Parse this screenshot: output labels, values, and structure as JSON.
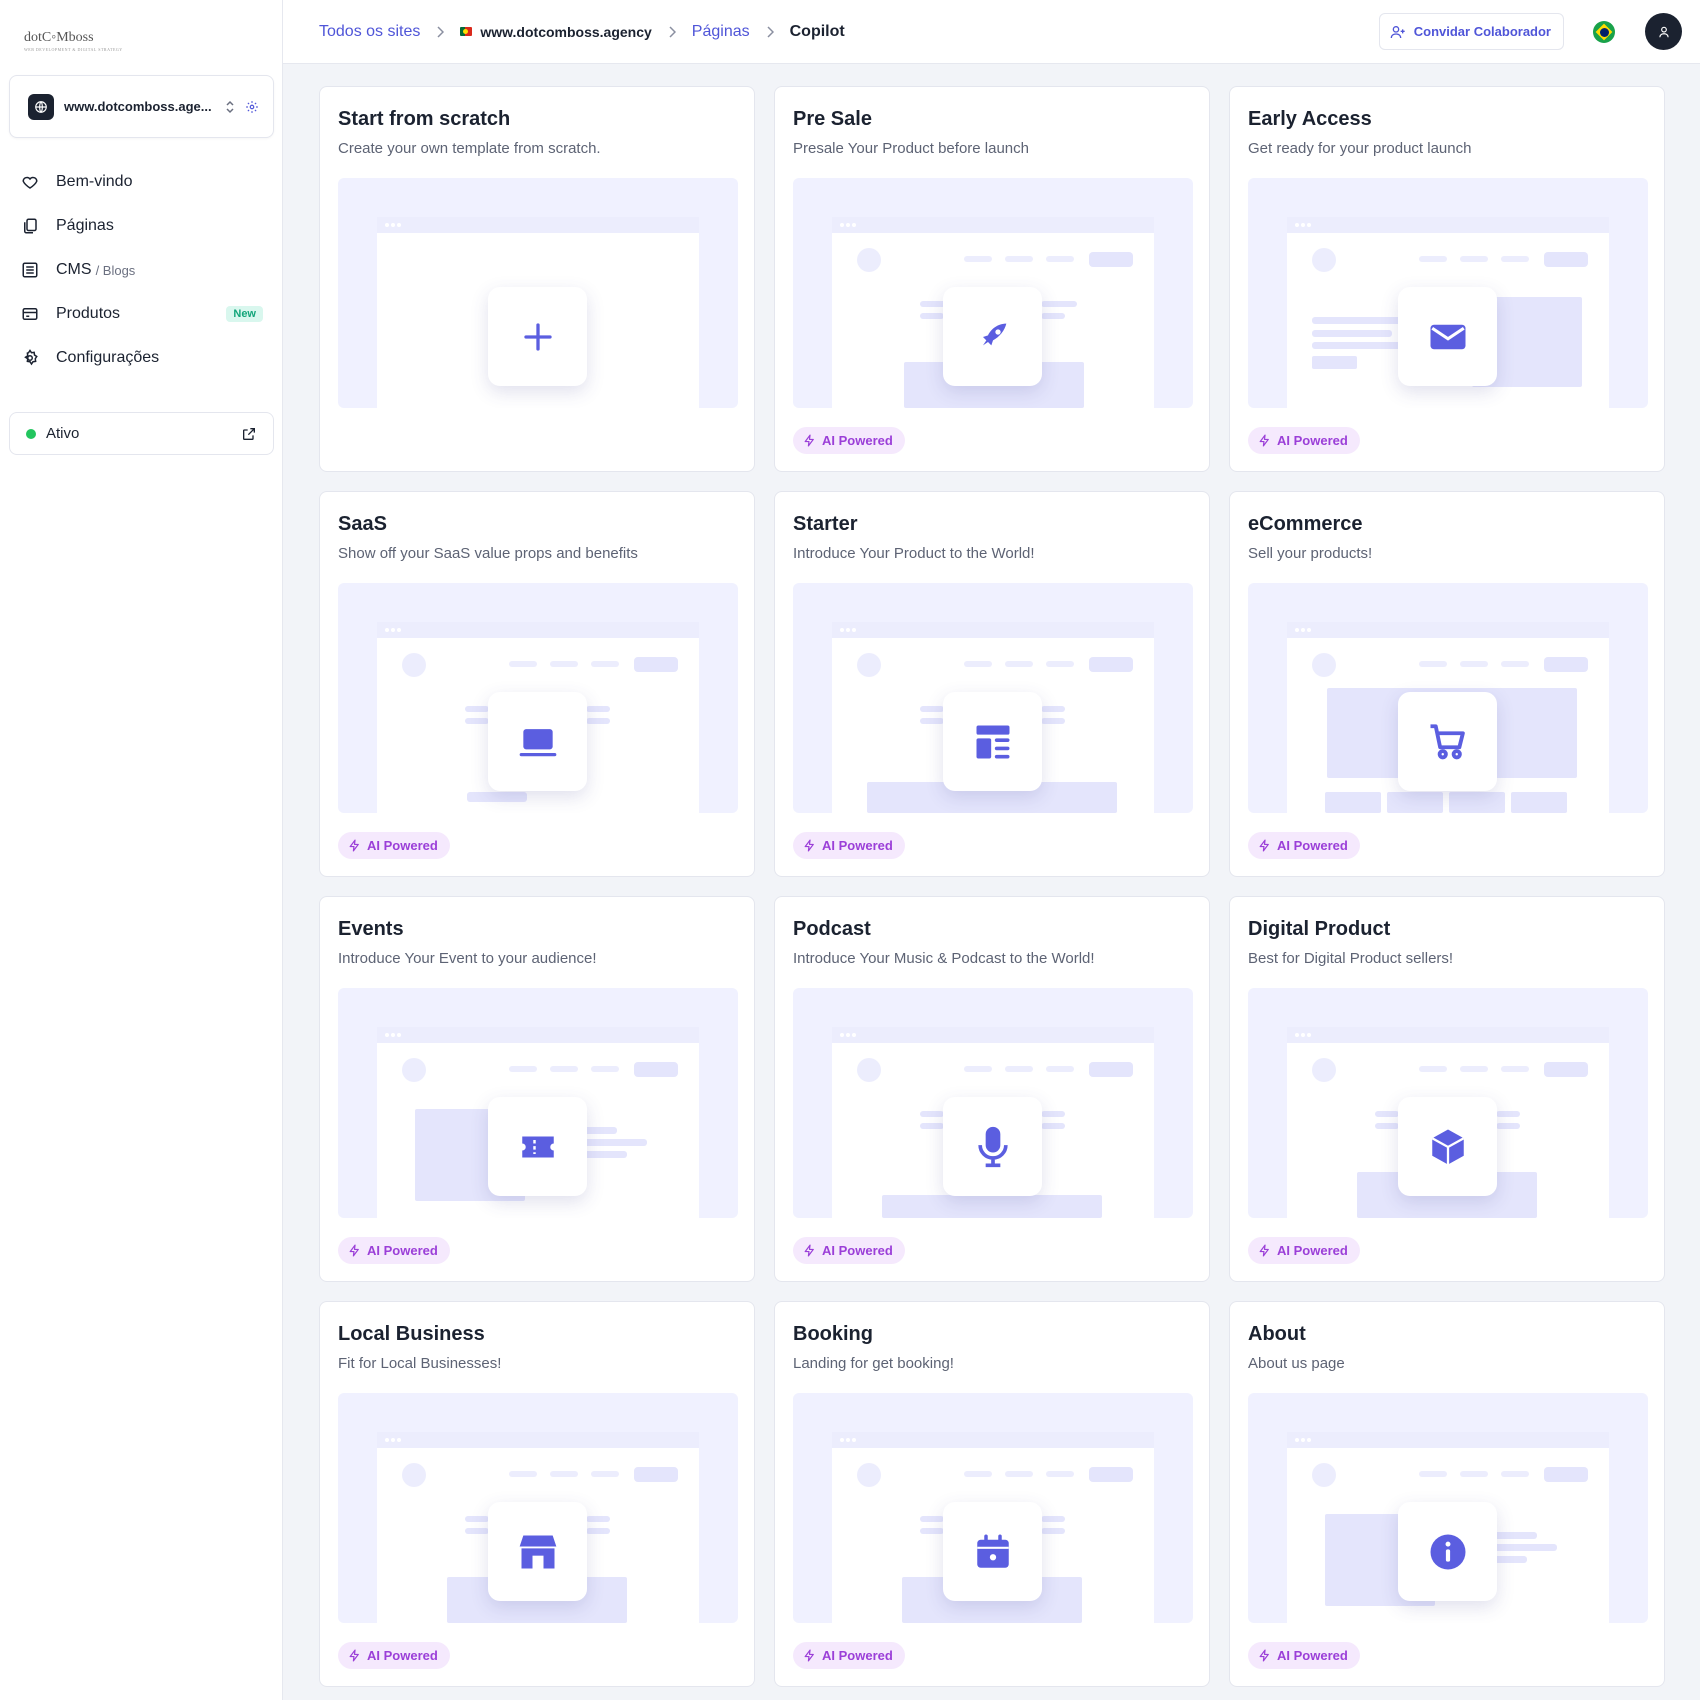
{
  "brand": {
    "logo_text": "dotC◦Mboss",
    "logo_tagline": "WEB DEVELOPMENT & DIGITAL STRATEGY"
  },
  "sidebar": {
    "site_selector": {
      "label": "www.dotcomboss.age..."
    },
    "items": [
      {
        "label": "Bem-vindo",
        "icon": "heart-icon"
      },
      {
        "label": "Páginas",
        "icon": "pages-icon"
      },
      {
        "label": "CMS",
        "sub": "/ Blogs",
        "icon": "cms-icon"
      },
      {
        "label": "Produtos",
        "badge": "New",
        "icon": "card-icon"
      },
      {
        "label": "Configurações",
        "icon": "gear-icon"
      }
    ],
    "status": {
      "label": "Ativo",
      "color": "#22c55e"
    }
  },
  "header": {
    "breadcrumb": [
      "Todos os sites",
      "www.dotcomboss.agency",
      "Páginas",
      "Copilot"
    ],
    "invite_label": "Convidar Colaborador"
  },
  "colors": {
    "accent": "#4f55d8",
    "icon": "#5b5ee0",
    "ai_badge_bg": "#f5e9fd",
    "ai_badge_text": "#9b3fd8"
  },
  "ai_badge_label": "AI Powered",
  "templates": [
    {
      "title": "Start from scratch",
      "description": "Create your own template from scratch.",
      "icon": "plus-icon",
      "ai": false
    },
    {
      "title": "Pre Sale",
      "description": "Presale Your Product before launch",
      "icon": "rocket-icon",
      "ai": true
    },
    {
      "title": "Early Access",
      "description": "Get ready for your product launch",
      "icon": "envelope-icon",
      "ai": true
    },
    {
      "title": "SaaS",
      "description": "Show off your SaaS value props and benefits",
      "icon": "laptop-icon",
      "ai": true
    },
    {
      "title": "Starter",
      "description": "Introduce Your Product to the World!",
      "icon": "layout-icon",
      "ai": true
    },
    {
      "title": "eCommerce",
      "description": "Sell your products!",
      "icon": "cart-icon",
      "ai": true
    },
    {
      "title": "Events",
      "description": "Introduce Your Event to your audience!",
      "icon": "ticket-icon",
      "ai": true
    },
    {
      "title": "Podcast",
      "description": "Introduce Your Music & Podcast to the World!",
      "icon": "microphone-icon",
      "ai": true
    },
    {
      "title": "Digital Product",
      "description": "Best for Digital Product sellers!",
      "icon": "cube-icon",
      "ai": true
    },
    {
      "title": "Local Business",
      "description": "Fit for Local Businesses!",
      "icon": "store-icon",
      "ai": true
    },
    {
      "title": "Booking",
      "description": "Landing for get booking!",
      "icon": "calendar-icon",
      "ai": true
    },
    {
      "title": "About",
      "description": "About us page",
      "icon": "info-icon",
      "ai": true
    }
  ]
}
